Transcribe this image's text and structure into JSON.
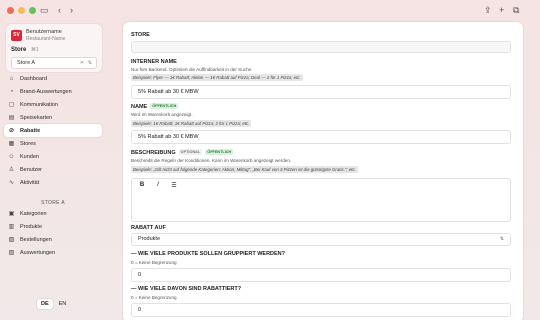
{
  "sidebar": {
    "user_name": "Benutzername",
    "restaurant_name": "Restaurant-Name",
    "avatar_initials": "SV",
    "store_label": "Store",
    "store_shortcut": "⌘1",
    "store_value": "Store A",
    "nav": [
      {
        "label": "Dashboard",
        "icon": "dashboard-icon"
      },
      {
        "label": "Brand-Auswertungen",
        "icon": "analytics-icon"
      },
      {
        "label": "Kommunikation",
        "icon": "chat-icon"
      },
      {
        "label": "Speisekarten",
        "icon": "menu-card-icon"
      },
      {
        "label": "Rabatte",
        "icon": "discount-icon",
        "active": true
      },
      {
        "label": "Stores",
        "icon": "store-icon"
      },
      {
        "label": "Kunden",
        "icon": "customers-icon"
      },
      {
        "label": "Benutzer",
        "icon": "user-icon"
      },
      {
        "label": "Aktivität",
        "icon": "activity-icon"
      }
    ],
    "section_title": "STORE A",
    "store_nav": [
      {
        "label": "Kategorien",
        "icon": "category-icon"
      },
      {
        "label": "Produkte",
        "icon": "product-icon"
      },
      {
        "label": "Bestellungen",
        "icon": "orders-icon"
      },
      {
        "label": "Auswertungen",
        "icon": "report-icon"
      }
    ],
    "lang_de": "DE",
    "lang_en": "EN"
  },
  "form": {
    "store_label": "STORE",
    "internal_name_label": "INTERNER NAME",
    "internal_name_hint": "Nur fürs Backend. Optimiert die Auffindbarkeit in der Suche.",
    "internal_name_example": "Beispiele: Flyer — 1€ Rabatt; Aktion — 1€ Rabatt auf Pizza; Deal — 2 für 1 Pizza; etc.",
    "internal_name_value": "5% Rabatt ab 30 € MBW",
    "name_label": "NAME",
    "name_badge": "ÖFFENTLICH",
    "name_hint": "Wird im Warenkorb angezeigt.",
    "name_example": "Beispiele: 1€ Rabatt; 1€ Rabatt auf Pizza; 2 für 1 Pizza; etc.",
    "name_value": "5% Rabatt ab 30 € MBW",
    "description_label": "BESCHREIBUNG",
    "description_badge_opt": "OPTIONAL",
    "description_badge_pub": "ÖFFENTLICH",
    "description_hint": "Beschreibt die Regeln der Konditionen. Kann im Warenkorb angezeigt werden.",
    "description_example": "Beispiele: „Gilt nicht auf folgende Kategorien: Aktion, Mittag“; „Bei Kauf von 3 Pizzen ist die günstigste Gratis.“; etc.",
    "toolbar_bold": "B",
    "toolbar_italic": "I",
    "toolbar_list": "☰",
    "discount_on_label": "RABATT AUF",
    "discount_on_value": "Produkte",
    "group_label": "— WIE VIELE PRODUKTE SOLLEN GRUPPIERT WERDEN?",
    "group_hint": "0 = Keine Begrenzung",
    "group_value": "0",
    "discounted_label": "— WIE VIELE DAVON SIND RABATTIERT?",
    "discounted_hint": "0 = Keine Begrenzung",
    "discounted_value": "0"
  }
}
